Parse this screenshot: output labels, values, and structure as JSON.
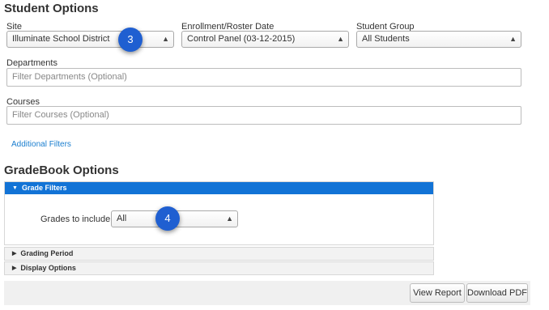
{
  "student_options": {
    "title": "Student Options",
    "site": {
      "label": "Site",
      "value": "Illuminate School District"
    },
    "enrollment": {
      "label": "Enrollment/Roster Date",
      "value": "Control Panel (03-12-2015)"
    },
    "student_group": {
      "label": "Student Group",
      "value": "All Students"
    },
    "departments": {
      "label": "Departments",
      "placeholder": "Filter Departments (Optional)"
    },
    "courses": {
      "label": "Courses",
      "placeholder": "Filter Courses (Optional)"
    },
    "additional_filters": "Additional Filters"
  },
  "gradebook_options": {
    "title": "GradeBook Options",
    "grade_filters": {
      "header": "Grade Filters",
      "grades_label": "Grades to include:",
      "grades_value": "All"
    },
    "grading_period": "Grading Period",
    "display_options": "Display Options"
  },
  "actions": {
    "view_report": "View Report",
    "download_pdf": "Download PDF"
  },
  "badges": {
    "step3": "3",
    "step4": "4"
  },
  "colors": {
    "accent": "#1273d6",
    "badge": "#1f5fd1",
    "link": "#1a7ecf"
  }
}
